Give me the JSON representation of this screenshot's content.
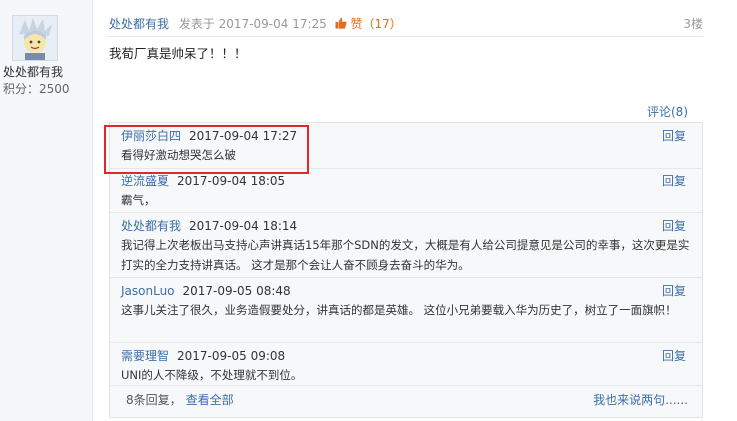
{
  "sidebar": {
    "username": "处处都有我",
    "points_label": "积分：2500"
  },
  "post": {
    "author": "处处都有我",
    "posted_label": "发表于 2017-09-04 17:25",
    "like_label": "赞",
    "like_count": "（17）",
    "floor": "3楼",
    "content": "我荀厂真是帅呆了！！！"
  },
  "comment_count_label": "评论(8)",
  "comments": [
    {
      "user": "伊丽莎白四",
      "time": "2017-09-04 17:27",
      "reply": "回复",
      "text": "看得好激动想哭怎么破"
    },
    {
      "user": "逆流盛夏",
      "time": "2017-09-04 18:05",
      "reply": "回复",
      "text": "霸气，"
    },
    {
      "user": "处处都有我",
      "time": "2017-09-04 18:14",
      "reply": "回复",
      "text": "我记得上次老板出马支持心声讲真话15年那个SDN的发文，大概是有人给公司提意见是公司的幸事，这次更是实打实的全力支持讲真话。 这才是那个会让人奋不顾身去奋斗的华为。"
    },
    {
      "user": "JasonLuo",
      "time": "2017-09-05 08:48",
      "reply": "回复",
      "text": "这事儿关注了很久，业务造假要处分，讲真话的都是英雄。 这位小兄弟要载入华为历史了，树立了一面旗帜！"
    },
    {
      "user": "需要理智",
      "time": "2017-09-05 09:08",
      "reply": "回复",
      "text": "UNI的人不降级，不处理就不到位。"
    }
  ],
  "footer": {
    "reply_count": "8条回复，",
    "view_all": "查看全部",
    "say_something": "我也来说两句......"
  },
  "colors": {
    "link": "#3d6ea8",
    "like": "#e86a1c",
    "highlight_border": "#e3262b"
  }
}
